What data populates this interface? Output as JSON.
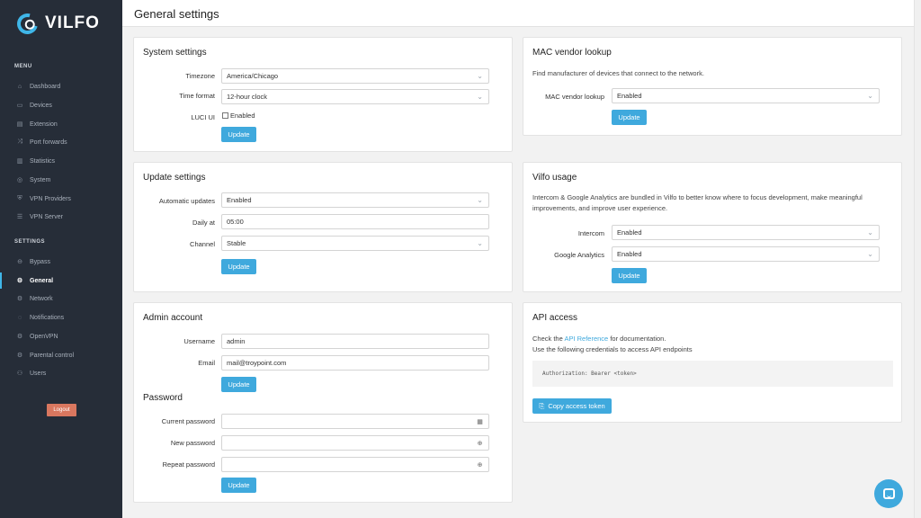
{
  "sidebar": {
    "brand": "VILFO",
    "menu_heading": "MENU",
    "menu_items": [
      {
        "label": "Dashboard",
        "icon": "dashboard-icon"
      },
      {
        "label": "Devices",
        "icon": "devices-icon"
      },
      {
        "label": "Extension",
        "icon": "extension-icon"
      },
      {
        "label": "Port forwards",
        "icon": "port-forward-icon"
      },
      {
        "label": "Statistics",
        "icon": "statistics-icon"
      },
      {
        "label": "System",
        "icon": "system-icon"
      },
      {
        "label": "VPN Providers",
        "icon": "vpn-providers-icon"
      },
      {
        "label": "VPN Server",
        "icon": "vpn-server-icon"
      }
    ],
    "settings_heading": "SETTINGS",
    "settings_items": [
      {
        "label": "Bypass",
        "icon": "bypass-icon"
      },
      {
        "label": "General",
        "icon": "general-icon",
        "active": true
      },
      {
        "label": "Network",
        "icon": "network-icon"
      },
      {
        "label": "Notifications",
        "icon": "notifications-icon"
      },
      {
        "label": "OpenVPN",
        "icon": "openvpn-icon"
      },
      {
        "label": "Parental control",
        "icon": "parental-control-icon"
      },
      {
        "label": "Users",
        "icon": "users-icon"
      }
    ],
    "logout_label": "Logout"
  },
  "header": {
    "title": "General settings"
  },
  "system_settings": {
    "title": "System settings",
    "timezone_label": "Timezone",
    "timezone_value": "America/Chicago",
    "time_format_label": "Time format",
    "time_format_value": "12-hour clock",
    "luci_label": "LUCI UI",
    "luci_checkbox_label": "Enabled",
    "update_label": "Update"
  },
  "update_settings": {
    "title": "Update settings",
    "auto_label": "Automatic updates",
    "auto_value": "Enabled",
    "daily_label": "Daily at",
    "daily_value": "05:00",
    "channel_label": "Channel",
    "channel_value": "Stable",
    "update_label": "Update"
  },
  "admin_account": {
    "title": "Admin account",
    "username_label": "Username",
    "username_value": "admin",
    "email_label": "Email",
    "email_value": "mail@troypoint.com",
    "update_label": "Update",
    "password_title": "Password",
    "current_password_label": "Current password",
    "new_password_label": "New password",
    "repeat_password_label": "Repeat password",
    "password_update_label": "Update"
  },
  "mac_lookup": {
    "title": "MAC vendor lookup",
    "description": "Find manufacturer of devices that connect to the network.",
    "field_label": "MAC vendor lookup",
    "field_value": "Enabled",
    "update_label": "Update"
  },
  "vilfo_usage": {
    "title": "Vilfo usage",
    "description_line1": "Intercom & Google Analytics are bundled in Vilfo to better know where to focus development, make meaningful",
    "description_line2": "improvements, and improve user experience.",
    "intercom_label": "Intercom",
    "intercom_value": "Enabled",
    "ga_label": "Google Analytics",
    "ga_value": "Enabled",
    "update_label": "Update"
  },
  "api_access": {
    "title": "API access",
    "check_prefix": "Check the ",
    "link_text": "API Reference",
    "check_suffix": " for documentation.",
    "credentials_text": "Use the following credentials to access API endpoints",
    "code": "Authorization: Bearer <token>",
    "copy_label": "Copy access token"
  },
  "colors": {
    "accent": "#3fa9dd",
    "sidebar_bg": "#262d38",
    "logout": "#d9775f"
  }
}
